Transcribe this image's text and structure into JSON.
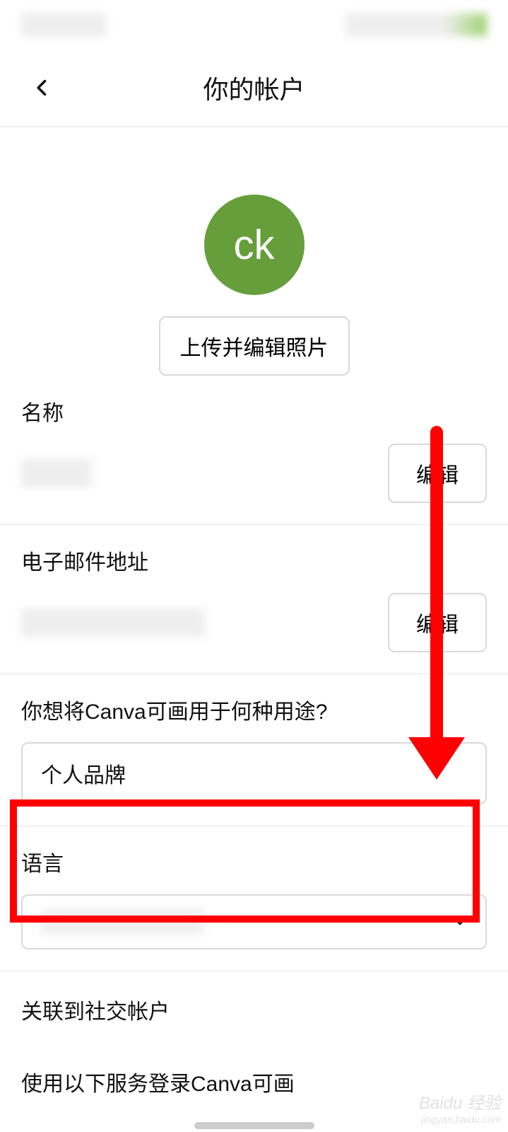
{
  "nav": {
    "title": "你的帐户"
  },
  "avatar": {
    "initials": "ck",
    "upload_label": "上传并编辑照片"
  },
  "name": {
    "label": "名称",
    "edit_label": "编辑"
  },
  "email": {
    "label": "电子邮件地址",
    "edit_label": "编辑"
  },
  "usage": {
    "label": "你想将Canva可画用于何种用途?",
    "value": "个人品牌"
  },
  "language": {
    "label": "语言"
  },
  "social": {
    "label": "关联到社交帐户"
  },
  "login": {
    "label": "使用以下服务登录Canva可画"
  },
  "watermark": {
    "brand": "Baidu 经验",
    "url": "jingyan.baidu.com"
  }
}
